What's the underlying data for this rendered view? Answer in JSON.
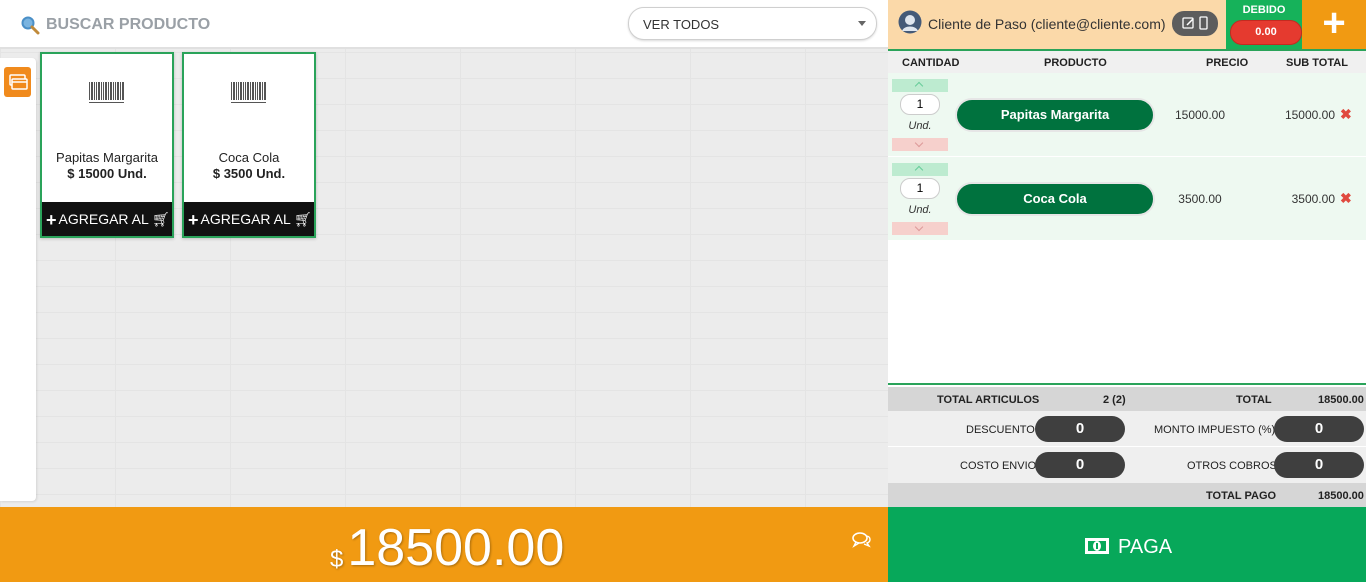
{
  "search": {
    "placeholder": "BUSCAR PRODUCTO"
  },
  "filter": {
    "selected": "VER TODOS"
  },
  "products": [
    {
      "name": "Papitas Margarita",
      "price": "$ 15000 Und.",
      "add_label": "AGREGAR AL"
    },
    {
      "name": "Coca Cola",
      "price": "$ 3500 Und.",
      "add_label": "AGREGAR AL"
    }
  ],
  "client": {
    "name": "Cliente de Paso (cliente@cliente.com)"
  },
  "debit": {
    "label": "DEBIDO",
    "value": "0.00"
  },
  "add_client_label": "+",
  "cart": {
    "headers": {
      "qty": "CANTIDAD",
      "product": "PRODUCTO",
      "price": "PRECIO",
      "subtotal": "SUB TOTAL"
    },
    "items": [
      {
        "qty": "1",
        "unit": "Und.",
        "product": "Papitas Margarita",
        "price": "15000.00",
        "subtotal": "15000.00"
      },
      {
        "qty": "1",
        "unit": "Und.",
        "product": "Coca Cola",
        "price": "3500.00",
        "subtotal": "3500.00"
      }
    ]
  },
  "summary": {
    "total_items_label": "TOTAL ARTICULOS",
    "total_items": "2 (2)",
    "total_label": "TOTAL",
    "total": "18500.00",
    "discount_label": "DESCUENTO",
    "discount": "0",
    "tax_label": "MONTO IMPUESTO (%)",
    "tax": "0",
    "shipping_label": "COSTO ENVIO",
    "shipping": "0",
    "other_label": "OTROS COBROS",
    "other": "0",
    "total_pay_label": "TOTAL PAGO",
    "total_pay": "18500.00"
  },
  "grand_total": {
    "currency": "$",
    "amount": "18500.00"
  },
  "pay_label": "PAGA",
  "colors": {
    "orange": "#f19a12",
    "green": "#07a85a",
    "dark_green": "#00723e",
    "red": "#e53a2f"
  }
}
